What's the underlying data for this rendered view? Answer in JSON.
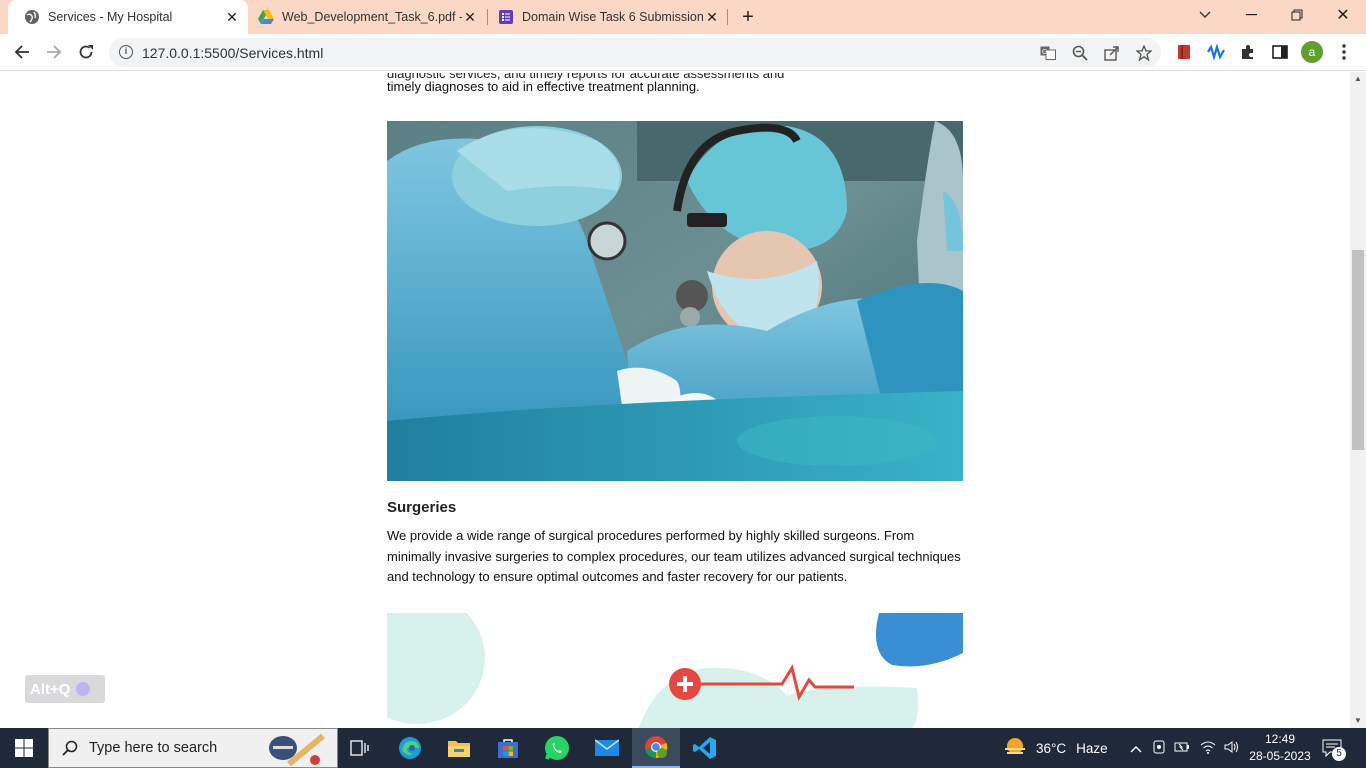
{
  "browser": {
    "tabs": [
      {
        "title": "Services - My Hospital",
        "active": true
      },
      {
        "title": "Web_Development_Task_6.pdf - G",
        "active": false
      },
      {
        "title": "Domain Wise Task 6 Submission",
        "active": false
      }
    ],
    "url": "127.0.0.1:5500/Services.html",
    "profile_initial": "a"
  },
  "page": {
    "partial_line": "diagnostic services, and timely reports for accurate assessments and",
    "prev_para_tail": "timely diagnoses to aid in effective treatment planning.",
    "service_title": "Surgeries",
    "service_description": "We provide a wide range of surgical procedures performed by highly skilled surgeons. From minimally invasive surgeries to complex procedures, our team utilizes advanced surgical techniques and technology to ensure optimal outcomes and faster recovery for our patients.",
    "shortcut_hint": "Alt+Q"
  },
  "taskbar": {
    "search_placeholder": "Type here to search",
    "weather_temp": "36°C",
    "weather_desc": "Haze",
    "time": "12:49",
    "date": "28-05-2023",
    "notifications": "5"
  },
  "colors": {
    "tabstrip": "#fad8c5",
    "taskbar": "#1e2a3a",
    "accent_red": "#e8473f",
    "accent_blue": "#3a8fd4",
    "mint": "#d7f2ec"
  }
}
